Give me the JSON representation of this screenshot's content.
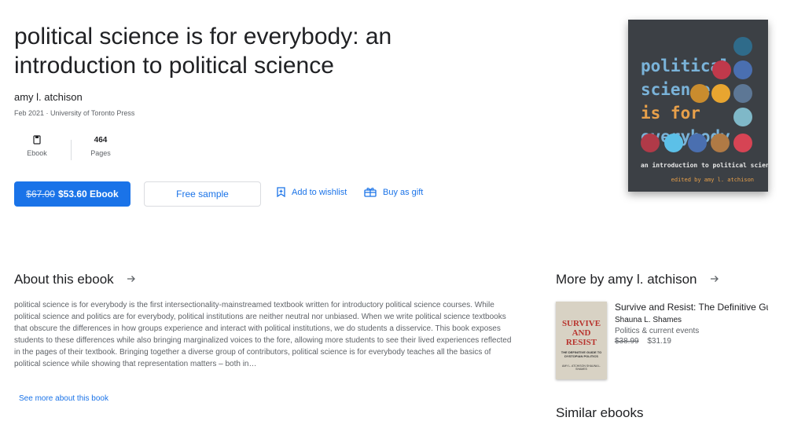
{
  "book": {
    "title": "political science is for everybody: an introduction to political science",
    "author": "amy l. atchison",
    "meta": "Feb 2021 · University of Toronto Press",
    "format_label": "Ebook",
    "pages_count": "464",
    "pages_label": "Pages"
  },
  "actions": {
    "old_price": "$67.00",
    "buy_label": "$53.60 Ebook",
    "sample_label": "Free sample",
    "wishlist_label": "Add to wishlist",
    "gift_label": "Buy as gift"
  },
  "cover": {
    "line1": "political",
    "line2": "science",
    "line3": "is for",
    "line4": "everybody",
    "subtitle": "an introduction to political science",
    "editor": "edited by amy l. atchison",
    "colors": {
      "background": "#3c4045",
      "title": "#7ab3d9",
      "accent": "#e8a04a"
    }
  },
  "about": {
    "heading": "About this ebook",
    "body": "political science is for everybody is the first intersectionality-mainstreamed textbook written for introductory political science courses. While political science and politics are for everybody, political institutions are neither neutral nor unbiased. When we write political science textbooks that obscure the differences in how groups experience and interact with political institutions, we do students a disservice. This book exposes students to these differences while also bringing marginalized voices to the fore, allowing more students to see their lived experiences reflected in the pages of their textbook. Bringing together a diverse group of contributors, political science is for everybody teaches all the basics of political science while showing that representation matters – both in…",
    "see_more": "See more about this book"
  },
  "more_by": {
    "heading": "More by amy l. atchison",
    "items": [
      {
        "title": "Survive and Resist: The Definitive Gui",
        "author": "Shauna L. Shames",
        "category": "Politics & current events",
        "old_price": "$38.99",
        "price": "$31.19",
        "cover_title": "SURVIVE AND RESIST",
        "cover_subtitle": "THE DEFINITIVE GUIDE TO DYSTOPIAN POLITICS",
        "cover_authors": "AMY L. ATCHISON SHAUNA L. SHAMES"
      }
    ]
  },
  "similar": {
    "heading": "Similar ebooks"
  },
  "colors": {
    "accent": "#1a73e8",
    "text": "#202124",
    "muted": "#5f6368"
  }
}
